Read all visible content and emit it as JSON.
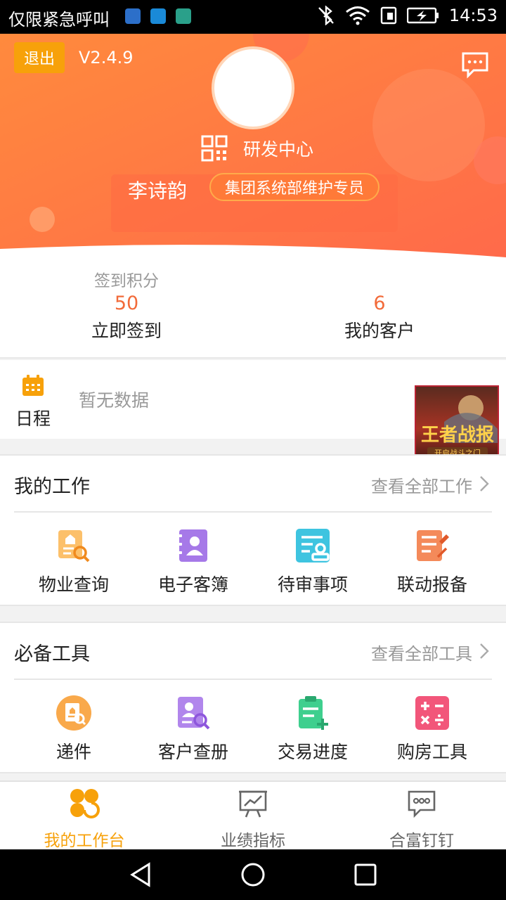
{
  "status_bar": {
    "carrier": "仅限紧急呼叫",
    "time": "14:53",
    "icons": [
      "notification-icon",
      "bluetooth-off-icon",
      "wifi-icon",
      "sim-icon",
      "battery-charging-icon"
    ]
  },
  "header": {
    "logout_label": "退出",
    "version": "V2.4.9",
    "message_icon": "message-icon",
    "qr_icon": "qr-code-icon",
    "department": "研发中心",
    "user_name": "李诗韵",
    "role": "集团系统部维护专员"
  },
  "stats": {
    "points_label": "签到积分",
    "points_value": "50",
    "checkin_label": "立即签到",
    "customers_value": "6",
    "customers_label": "我的客户"
  },
  "schedule": {
    "label": "日程",
    "empty_text": "暂无数据",
    "ad_text": "王者战报",
    "ad_sub": "开启战斗之门"
  },
  "my_work": {
    "title": "我的工作",
    "more_label": "查看全部工作",
    "items": [
      {
        "label": "物业查询",
        "icon": "property-search-icon",
        "color": "#f9a94b"
      },
      {
        "label": "电子客簿",
        "icon": "contact-book-icon",
        "color": "#a679e8"
      },
      {
        "label": "待审事项",
        "icon": "pending-review-icon",
        "color": "#3ec4e0"
      },
      {
        "label": "联动报备",
        "icon": "report-icon",
        "color": "#f27a4a"
      }
    ]
  },
  "tools": {
    "title": "必备工具",
    "more_label": "查看全部工具",
    "items": [
      {
        "label": "递件",
        "icon": "submit-document-icon",
        "color": "#f9a94b"
      },
      {
        "label": "客户查册",
        "icon": "customer-lookup-icon",
        "color": "#a679e8"
      },
      {
        "label": "交易进度",
        "icon": "transaction-progress-icon",
        "color": "#3ecf8e"
      },
      {
        "label": "购房工具",
        "icon": "calculator-icon",
        "color": "#f2567a"
      }
    ]
  },
  "tab_bar": {
    "tabs": [
      {
        "label": "我的工作台",
        "icon": "clover-icon",
        "active": true
      },
      {
        "label": "业绩指标",
        "icon": "chart-board-icon",
        "active": false
      },
      {
        "label": "合富钉钉",
        "icon": "chat-bubble-icon",
        "active": false
      }
    ],
    "active_color": "#f7a10a"
  },
  "colors": {
    "header_gradient_start": "#ff8a3d",
    "header_gradient_end": "#ff6a4a",
    "accent": "#f26b3a"
  }
}
